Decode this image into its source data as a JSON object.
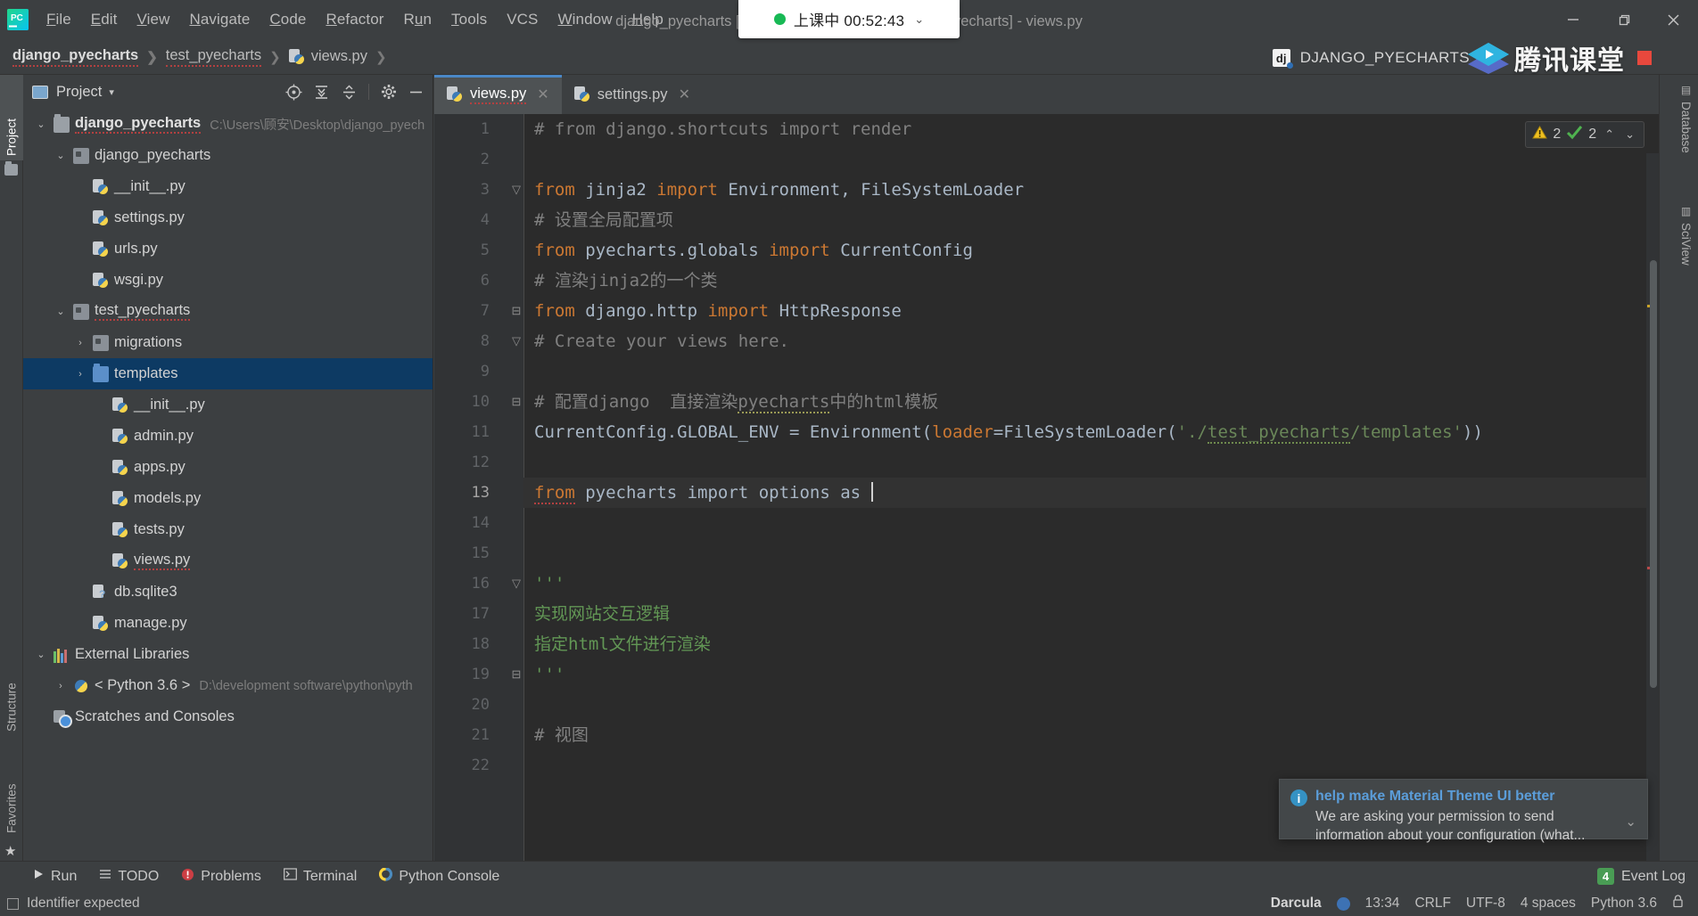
{
  "titlebar": {
    "app_icon": "pycharm-logo-icon",
    "menus": [
      "File",
      "Edit",
      "View",
      "Navigate",
      "Code",
      "Refactor",
      "Run",
      "Tools",
      "VCS",
      "Window",
      "Help"
    ],
    "window_title": "django_pyecharts [C:\\Users\\顾安\\Desktop\\django_pyecharts] - views.py",
    "minimize_label": "—",
    "maximize_label": "❐",
    "close_label": "✕"
  },
  "class_pill": {
    "status_text": "上课中 00:52:43",
    "caret": "⌄",
    "dot_color": "#18b955"
  },
  "watermark": {
    "project_badge": "dj",
    "project_name": "DJANGO_PYECHARTS",
    "brand_cn": "腾讯课堂",
    "record_color": "#e8483d"
  },
  "breadcrumb": [
    {
      "label": "django_pyecharts",
      "bold": true,
      "squiggle": true
    },
    {
      "label": "test_pyecharts",
      "bold": false,
      "squiggle": true
    },
    {
      "label": "views.py",
      "bold": false,
      "squiggle": false,
      "icon": "python-file-icon"
    }
  ],
  "left_tabs": [
    {
      "label": "Project",
      "icon": "project-icon",
      "active": true
    },
    {
      "label": "Structure",
      "icon": "structure-icon",
      "active": false
    },
    {
      "label": "Favorites",
      "icon": "star-icon",
      "active": false
    }
  ],
  "right_tabs": [
    {
      "label": "Database",
      "icon": "database-icon"
    },
    {
      "label": "SciView",
      "icon": "sciview-icon"
    }
  ],
  "project_panel": {
    "title": "Project",
    "caret": "▾",
    "tools": [
      {
        "name": "select-opened-file-icon",
        "glyph": "◉"
      },
      {
        "name": "expand-all-icon",
        "glyph": "⤓"
      },
      {
        "name": "collapse-all-icon",
        "glyph": "⤒"
      },
      {
        "name": "settings-gear-icon",
        "glyph": "✷"
      },
      {
        "name": "hide-panel-icon",
        "glyph": "—"
      }
    ],
    "tree": [
      {
        "indent": 0,
        "arrow": "v",
        "icon": "folder",
        "label": "django_pyecharts",
        "bold": true,
        "squiggle": true,
        "path": "C:\\Users\\顾安\\Desktop\\django_pyech",
        "selected": false
      },
      {
        "indent": 1,
        "arrow": "v",
        "icon": "folder-src",
        "label": "django_pyecharts",
        "bold": false,
        "squiggle": false,
        "path": "",
        "selected": false
      },
      {
        "indent": 2,
        "arrow": "",
        "icon": "py",
        "label": "__init__.py",
        "bold": false,
        "squiggle": false,
        "path": "",
        "selected": false
      },
      {
        "indent": 2,
        "arrow": "",
        "icon": "py",
        "label": "settings.py",
        "bold": false,
        "squiggle": false,
        "path": "",
        "selected": false
      },
      {
        "indent": 2,
        "arrow": "",
        "icon": "py",
        "label": "urls.py",
        "bold": false,
        "squiggle": false,
        "path": "",
        "selected": false
      },
      {
        "indent": 2,
        "arrow": "",
        "icon": "py",
        "label": "wsgi.py",
        "bold": false,
        "squiggle": false,
        "path": "",
        "selected": false
      },
      {
        "indent": 1,
        "arrow": "v",
        "icon": "folder-src",
        "label": "test_pyecharts",
        "bold": false,
        "squiggle": true,
        "path": "",
        "selected": false
      },
      {
        "indent": 2,
        "arrow": ">",
        "icon": "folder-src",
        "label": "migrations",
        "bold": false,
        "squiggle": false,
        "path": "",
        "selected": false
      },
      {
        "indent": 2,
        "arrow": ">",
        "icon": "folder-blue",
        "label": "templates",
        "bold": false,
        "squiggle": false,
        "path": "",
        "selected": true
      },
      {
        "indent": 3,
        "arrow": "",
        "icon": "py",
        "label": "__init__.py",
        "bold": false,
        "squiggle": false,
        "path": "",
        "selected": false
      },
      {
        "indent": 3,
        "arrow": "",
        "icon": "py",
        "label": "admin.py",
        "bold": false,
        "squiggle": false,
        "path": "",
        "selected": false
      },
      {
        "indent": 3,
        "arrow": "",
        "icon": "py",
        "label": "apps.py",
        "bold": false,
        "squiggle": false,
        "path": "",
        "selected": false
      },
      {
        "indent": 3,
        "arrow": "",
        "icon": "py",
        "label": "models.py",
        "bold": false,
        "squiggle": false,
        "path": "",
        "selected": false
      },
      {
        "indent": 3,
        "arrow": "",
        "icon": "py",
        "label": "tests.py",
        "bold": false,
        "squiggle": false,
        "path": "",
        "selected": false
      },
      {
        "indent": 3,
        "arrow": "",
        "icon": "py",
        "label": "views.py",
        "bold": false,
        "squiggle": true,
        "path": "",
        "selected": false
      },
      {
        "indent": 2,
        "arrow": "",
        "icon": "db",
        "label": "db.sqlite3",
        "bold": false,
        "squiggle": false,
        "path": "",
        "selected": false
      },
      {
        "indent": 2,
        "arrow": "",
        "icon": "py",
        "label": "manage.py",
        "bold": false,
        "squiggle": false,
        "path": "",
        "selected": false
      },
      {
        "indent": 0,
        "arrow": "v",
        "icon": "lib",
        "label": "External Libraries",
        "bold": false,
        "squiggle": false,
        "path": "",
        "selected": false
      },
      {
        "indent": 1,
        "arrow": ">",
        "icon": "pysnake",
        "label": "< Python 3.6 >",
        "bold": false,
        "squiggle": false,
        "path": "D:\\development software\\python\\pyth",
        "selected": false
      },
      {
        "indent": 0,
        "arrow": "",
        "icon": "scratch",
        "label": "Scratches and Consoles",
        "bold": false,
        "squiggle": false,
        "path": "",
        "selected": false
      }
    ]
  },
  "editor": {
    "tabs": [
      {
        "label": "views.py",
        "active": true,
        "squiggle": true,
        "close": "✕"
      },
      {
        "label": "settings.py",
        "active": false,
        "squiggle": false,
        "close": "✕"
      }
    ],
    "inspection": {
      "warning_icon": "warning-triangle-icon",
      "warning_count": "2",
      "ok_icon": "green-check-icon",
      "ok_count": "2",
      "prev_glyph": "⌃",
      "next_glyph": "⌄"
    },
    "lines": [
      {
        "n": "1",
        "fold": "",
        "current": false,
        "tokens": [
          {
            "t": "# from django.shortcuts import render",
            "c": "cm"
          }
        ]
      },
      {
        "n": "2",
        "fold": "",
        "current": false,
        "tokens": []
      },
      {
        "n": "3",
        "fold": "▽",
        "current": false,
        "tokens": [
          {
            "t": "from",
            "c": "kw"
          },
          {
            "t": " jinja2 ",
            "c": "id"
          },
          {
            "t": "import",
            "c": "kw"
          },
          {
            "t": " Environment, FileSystemLoader",
            "c": "id"
          }
        ]
      },
      {
        "n": "4",
        "fold": "",
        "current": false,
        "tokens": [
          {
            "t": "# 设置全局配置项",
            "c": "cm"
          }
        ]
      },
      {
        "n": "5",
        "fold": "",
        "current": false,
        "tokens": [
          {
            "t": "from",
            "c": "kw"
          },
          {
            "t": " pyecharts.globals ",
            "c": "id"
          },
          {
            "t": "import",
            "c": "kw"
          },
          {
            "t": " CurrentConfig",
            "c": "id"
          }
        ]
      },
      {
        "n": "6",
        "fold": "",
        "current": false,
        "tokens": [
          {
            "t": "# 渲染jinja2的一个类",
            "c": "cm"
          }
        ]
      },
      {
        "n": "7",
        "fold": "⊟",
        "current": false,
        "tokens": [
          {
            "t": "from",
            "c": "kw"
          },
          {
            "t": " django.http ",
            "c": "id"
          },
          {
            "t": "import",
            "c": "kw"
          },
          {
            "t": " HttpResponse",
            "c": "id"
          }
        ]
      },
      {
        "n": "8",
        "fold": "▽",
        "current": false,
        "tokens": [
          {
            "t": "# Create your views here.",
            "c": "cm"
          }
        ]
      },
      {
        "n": "9",
        "fold": "",
        "current": false,
        "tokens": []
      },
      {
        "n": "10",
        "fold": "⊟",
        "current": false,
        "tokens": [
          {
            "t": "# 配置django  直接渲染",
            "c": "cm"
          },
          {
            "t": "pyecharts",
            "c": "cm wavy"
          },
          {
            "t": "中的html模板",
            "c": "cm"
          }
        ]
      },
      {
        "n": "11",
        "fold": "",
        "current": false,
        "tokens": [
          {
            "t": "CurrentConfig.GLOBAL_ENV = Environment(",
            "c": "id"
          },
          {
            "t": "loader",
            "c": "param"
          },
          {
            "t": "=FileSystemLoader(",
            "c": "id"
          },
          {
            "t": "'./",
            "c": "str"
          },
          {
            "t": "test_pyecharts",
            "c": "str wavy-grn"
          },
          {
            "t": "/templates'",
            "c": "str"
          },
          {
            "t": "))",
            "c": "id"
          }
        ]
      },
      {
        "n": "12",
        "fold": "",
        "current": false,
        "tokens": []
      },
      {
        "n": "13",
        "fold": "",
        "current": true,
        "tokens": [
          {
            "t": "from",
            "c": "kw wavy-red"
          },
          {
            "t": " pyecharts ",
            "c": "id"
          },
          {
            "t": "import",
            "c": "id"
          },
          {
            "t": " options ",
            "c": "id"
          },
          {
            "t": "as",
            "c": "id"
          },
          {
            "t": " ",
            "c": "id"
          }
        ],
        "caret": true
      },
      {
        "n": "14",
        "fold": "",
        "current": false,
        "tokens": []
      },
      {
        "n": "15",
        "fold": "",
        "current": false,
        "tokens": []
      },
      {
        "n": "16",
        "fold": "▽",
        "current": false,
        "tokens": [
          {
            "t": "'''",
            "c": "docstr"
          }
        ]
      },
      {
        "n": "17",
        "fold": "",
        "current": false,
        "tokens": [
          {
            "t": "实现网站交互逻辑",
            "c": "docstr"
          }
        ]
      },
      {
        "n": "18",
        "fold": "",
        "current": false,
        "tokens": [
          {
            "t": "指定html文件进行渲染",
            "c": "docstr"
          }
        ]
      },
      {
        "n": "19",
        "fold": "⊟",
        "current": false,
        "tokens": [
          {
            "t": "'''",
            "c": "docstr"
          }
        ]
      },
      {
        "n": "20",
        "fold": "",
        "current": false,
        "tokens": []
      },
      {
        "n": "21",
        "fold": "",
        "current": false,
        "tokens": [
          {
            "t": "# 视图",
            "c": "cm"
          }
        ]
      },
      {
        "n": "22",
        "fold": "",
        "current": false,
        "tokens": []
      }
    ]
  },
  "notification": {
    "icon": "info-icon",
    "title": "help make Material Theme UI better",
    "text": "We are asking your permission to send information about your configuration (what...",
    "expand_glyph": "⌄"
  },
  "bottom_toolbar": [
    {
      "label": "Run",
      "icon": "run-play-icon",
      "glyph": "▶"
    },
    {
      "label": "TODO",
      "icon": "todo-list-icon",
      "glyph": "☰"
    },
    {
      "label": "Problems",
      "icon": "problems-error-icon",
      "glyph": "!"
    },
    {
      "label": "Terminal",
      "icon": "terminal-icon",
      "glyph": "▣"
    },
    {
      "label": "Python Console",
      "icon": "python-console-icon",
      "glyph": "❧"
    }
  ],
  "event_log": {
    "label": "Event Log",
    "badge": "4",
    "badge_color": "#499c54"
  },
  "statusbar": {
    "message": "Identifier expected",
    "message_icon": "inspection-square-icon",
    "theme": "Darcula",
    "theme_dot_color": "#3d72b4",
    "position": "13:34",
    "line_separator": "CRLF",
    "encoding": "UTF-8",
    "indent": "4 spaces",
    "interpreter": "Python 3.6",
    "lock_glyph": "⌂"
  }
}
